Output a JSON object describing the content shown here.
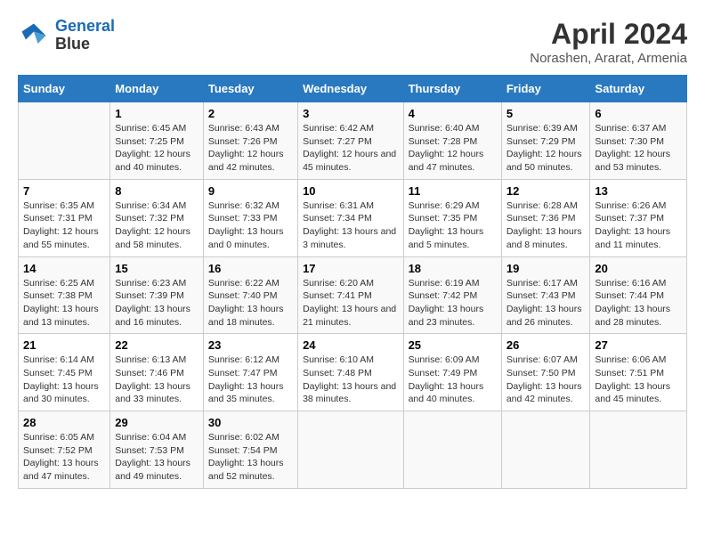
{
  "logo": {
    "line1": "General",
    "line2": "Blue"
  },
  "title": "April 2024",
  "subtitle": "Norashen, Ararat, Armenia",
  "days_of_week": [
    "Sunday",
    "Monday",
    "Tuesday",
    "Wednesday",
    "Thursday",
    "Friday",
    "Saturday"
  ],
  "weeks": [
    [
      {
        "day": "",
        "sunrise": "",
        "sunset": "",
        "daylight": ""
      },
      {
        "day": "1",
        "sunrise": "Sunrise: 6:45 AM",
        "sunset": "Sunset: 7:25 PM",
        "daylight": "Daylight: 12 hours and 40 minutes."
      },
      {
        "day": "2",
        "sunrise": "Sunrise: 6:43 AM",
        "sunset": "Sunset: 7:26 PM",
        "daylight": "Daylight: 12 hours and 42 minutes."
      },
      {
        "day": "3",
        "sunrise": "Sunrise: 6:42 AM",
        "sunset": "Sunset: 7:27 PM",
        "daylight": "Daylight: 12 hours and 45 minutes."
      },
      {
        "day": "4",
        "sunrise": "Sunrise: 6:40 AM",
        "sunset": "Sunset: 7:28 PM",
        "daylight": "Daylight: 12 hours and 47 minutes."
      },
      {
        "day": "5",
        "sunrise": "Sunrise: 6:39 AM",
        "sunset": "Sunset: 7:29 PM",
        "daylight": "Daylight: 12 hours and 50 minutes."
      },
      {
        "day": "6",
        "sunrise": "Sunrise: 6:37 AM",
        "sunset": "Sunset: 7:30 PM",
        "daylight": "Daylight: 12 hours and 53 minutes."
      }
    ],
    [
      {
        "day": "7",
        "sunrise": "Sunrise: 6:35 AM",
        "sunset": "Sunset: 7:31 PM",
        "daylight": "Daylight: 12 hours and 55 minutes."
      },
      {
        "day": "8",
        "sunrise": "Sunrise: 6:34 AM",
        "sunset": "Sunset: 7:32 PM",
        "daylight": "Daylight: 12 hours and 58 minutes."
      },
      {
        "day": "9",
        "sunrise": "Sunrise: 6:32 AM",
        "sunset": "Sunset: 7:33 PM",
        "daylight": "Daylight: 13 hours and 0 minutes."
      },
      {
        "day": "10",
        "sunrise": "Sunrise: 6:31 AM",
        "sunset": "Sunset: 7:34 PM",
        "daylight": "Daylight: 13 hours and 3 minutes."
      },
      {
        "day": "11",
        "sunrise": "Sunrise: 6:29 AM",
        "sunset": "Sunset: 7:35 PM",
        "daylight": "Daylight: 13 hours and 5 minutes."
      },
      {
        "day": "12",
        "sunrise": "Sunrise: 6:28 AM",
        "sunset": "Sunset: 7:36 PM",
        "daylight": "Daylight: 13 hours and 8 minutes."
      },
      {
        "day": "13",
        "sunrise": "Sunrise: 6:26 AM",
        "sunset": "Sunset: 7:37 PM",
        "daylight": "Daylight: 13 hours and 11 minutes."
      }
    ],
    [
      {
        "day": "14",
        "sunrise": "Sunrise: 6:25 AM",
        "sunset": "Sunset: 7:38 PM",
        "daylight": "Daylight: 13 hours and 13 minutes."
      },
      {
        "day": "15",
        "sunrise": "Sunrise: 6:23 AM",
        "sunset": "Sunset: 7:39 PM",
        "daylight": "Daylight: 13 hours and 16 minutes."
      },
      {
        "day": "16",
        "sunrise": "Sunrise: 6:22 AM",
        "sunset": "Sunset: 7:40 PM",
        "daylight": "Daylight: 13 hours and 18 minutes."
      },
      {
        "day": "17",
        "sunrise": "Sunrise: 6:20 AM",
        "sunset": "Sunset: 7:41 PM",
        "daylight": "Daylight: 13 hours and 21 minutes."
      },
      {
        "day": "18",
        "sunrise": "Sunrise: 6:19 AM",
        "sunset": "Sunset: 7:42 PM",
        "daylight": "Daylight: 13 hours and 23 minutes."
      },
      {
        "day": "19",
        "sunrise": "Sunrise: 6:17 AM",
        "sunset": "Sunset: 7:43 PM",
        "daylight": "Daylight: 13 hours and 26 minutes."
      },
      {
        "day": "20",
        "sunrise": "Sunrise: 6:16 AM",
        "sunset": "Sunset: 7:44 PM",
        "daylight": "Daylight: 13 hours and 28 minutes."
      }
    ],
    [
      {
        "day": "21",
        "sunrise": "Sunrise: 6:14 AM",
        "sunset": "Sunset: 7:45 PM",
        "daylight": "Daylight: 13 hours and 30 minutes."
      },
      {
        "day": "22",
        "sunrise": "Sunrise: 6:13 AM",
        "sunset": "Sunset: 7:46 PM",
        "daylight": "Daylight: 13 hours and 33 minutes."
      },
      {
        "day": "23",
        "sunrise": "Sunrise: 6:12 AM",
        "sunset": "Sunset: 7:47 PM",
        "daylight": "Daylight: 13 hours and 35 minutes."
      },
      {
        "day": "24",
        "sunrise": "Sunrise: 6:10 AM",
        "sunset": "Sunset: 7:48 PM",
        "daylight": "Daylight: 13 hours and 38 minutes."
      },
      {
        "day": "25",
        "sunrise": "Sunrise: 6:09 AM",
        "sunset": "Sunset: 7:49 PM",
        "daylight": "Daylight: 13 hours and 40 minutes."
      },
      {
        "day": "26",
        "sunrise": "Sunrise: 6:07 AM",
        "sunset": "Sunset: 7:50 PM",
        "daylight": "Daylight: 13 hours and 42 minutes."
      },
      {
        "day": "27",
        "sunrise": "Sunrise: 6:06 AM",
        "sunset": "Sunset: 7:51 PM",
        "daylight": "Daylight: 13 hours and 45 minutes."
      }
    ],
    [
      {
        "day": "28",
        "sunrise": "Sunrise: 6:05 AM",
        "sunset": "Sunset: 7:52 PM",
        "daylight": "Daylight: 13 hours and 47 minutes."
      },
      {
        "day": "29",
        "sunrise": "Sunrise: 6:04 AM",
        "sunset": "Sunset: 7:53 PM",
        "daylight": "Daylight: 13 hours and 49 minutes."
      },
      {
        "day": "30",
        "sunrise": "Sunrise: 6:02 AM",
        "sunset": "Sunset: 7:54 PM",
        "daylight": "Daylight: 13 hours and 52 minutes."
      },
      {
        "day": "",
        "sunrise": "",
        "sunset": "",
        "daylight": ""
      },
      {
        "day": "",
        "sunrise": "",
        "sunset": "",
        "daylight": ""
      },
      {
        "day": "",
        "sunrise": "",
        "sunset": "",
        "daylight": ""
      },
      {
        "day": "",
        "sunrise": "",
        "sunset": "",
        "daylight": ""
      }
    ]
  ]
}
